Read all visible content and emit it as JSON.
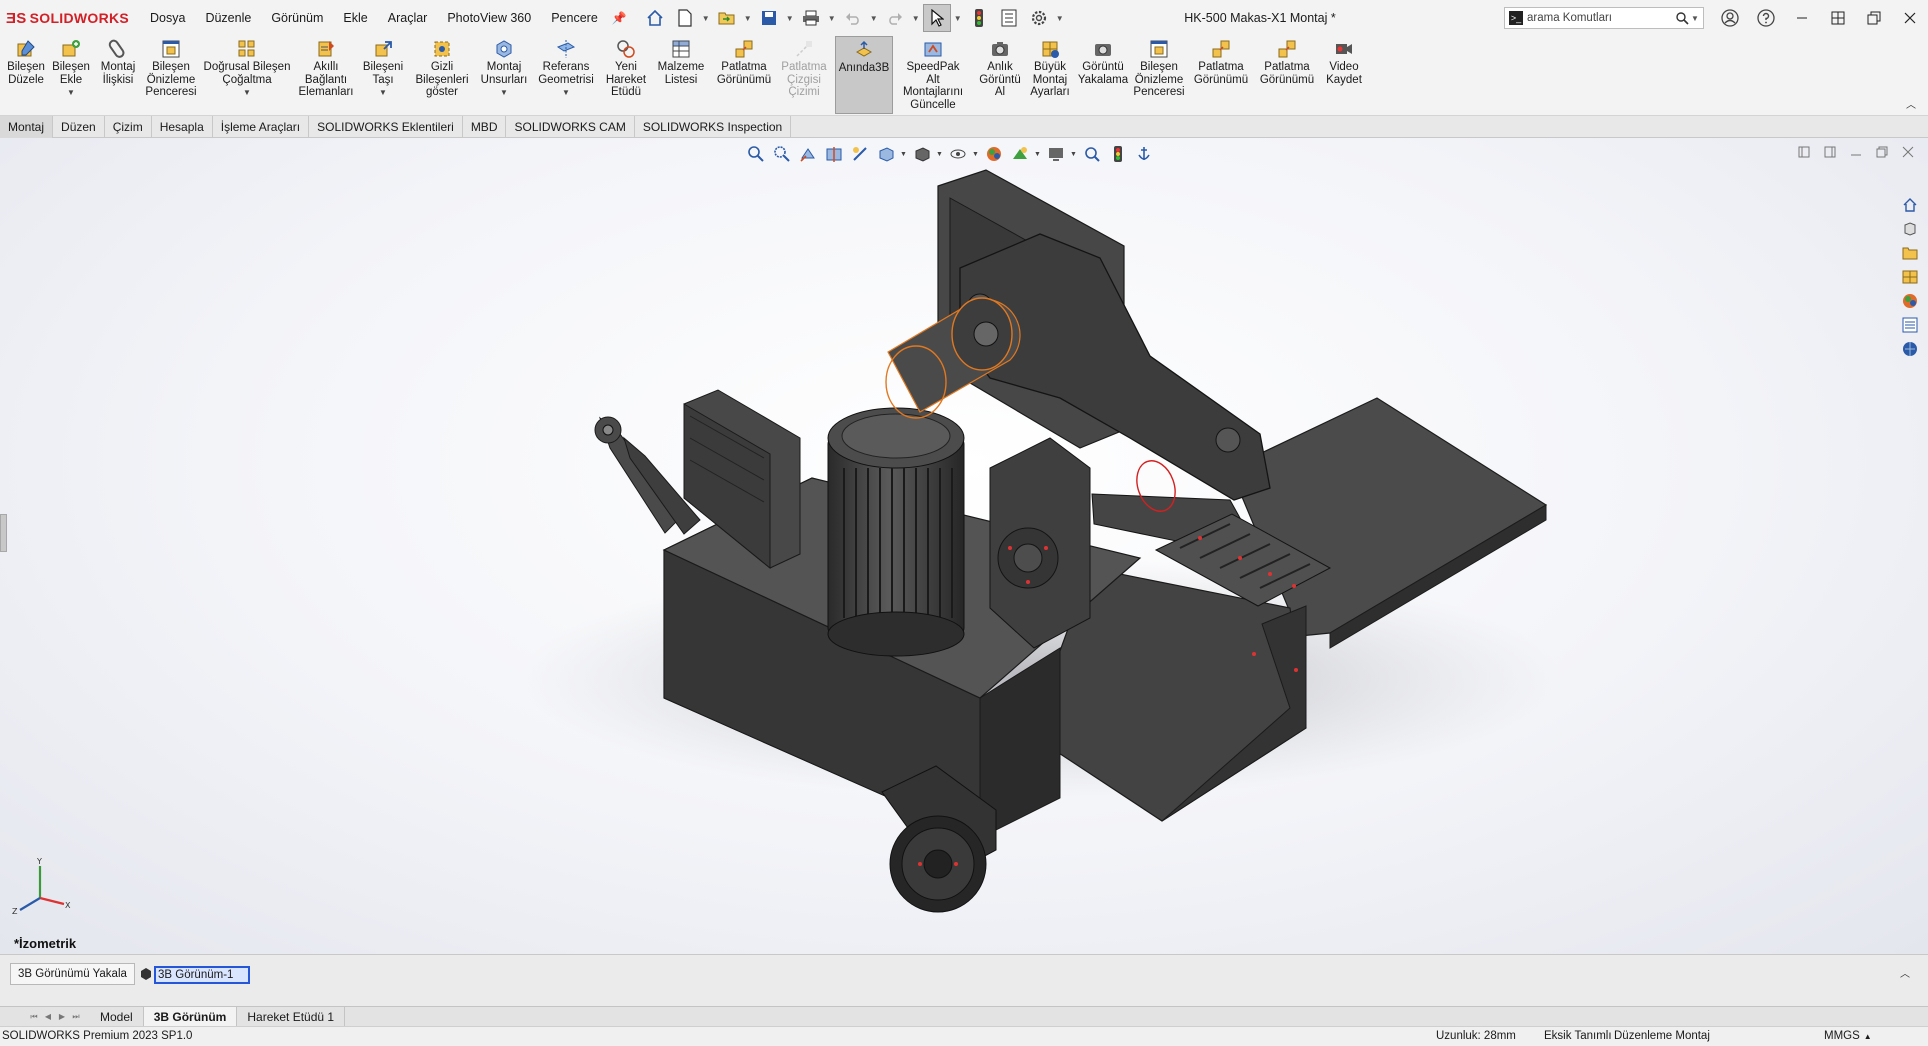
{
  "app": {
    "brand": "SOLIDWORKS",
    "document_title": "HK-500 Makas-X1 Montaj *"
  },
  "menu": [
    "Dosya",
    "Düzenle",
    "Görünüm",
    "Ekle",
    "Araçlar",
    "PhotoView 360",
    "Pencere"
  ],
  "search": {
    "placeholder": "arama Komutları"
  },
  "ribbon": {
    "buttons": [
      {
        "label": "Bileşen\nDüzele",
        "icon": "edit-component-icon"
      },
      {
        "label": "Bileşen\nEkle",
        "icon": "insert-component-icon"
      },
      {
        "label": "Montaj\nİlişkisi",
        "icon": "mate-icon"
      },
      {
        "label": "Bileşen\nÖnizleme\nPenceresi",
        "icon": "component-preview-icon"
      },
      {
        "label": "Doğrusal Bileşen\nÇoğaltma",
        "icon": "linear-pattern-icon"
      },
      {
        "label": "Akıllı\nBağlantı\nElemanları",
        "icon": "smart-fasteners-icon"
      },
      {
        "label": "Bileşeni\nTaşı",
        "icon": "move-component-icon"
      },
      {
        "label": "Gizli\nBileşenleri\ngöster",
        "icon": "show-hidden-icon"
      },
      {
        "label": "Montaj\nUnsurları",
        "icon": "assembly-features-icon"
      },
      {
        "label": "Referans\nGeometrisi",
        "icon": "reference-geometry-icon"
      },
      {
        "label": "Yeni\nHareket\nEtüdü",
        "icon": "new-motion-study-icon"
      },
      {
        "label": "Malzeme\nListesi",
        "icon": "bom-icon"
      },
      {
        "label": "Patlatma\nGörünümü",
        "icon": "exploded-view-icon"
      },
      {
        "label": "Patlatma\nÇizgisi\nÇizimi",
        "icon": "explode-line-icon"
      },
      {
        "label": "Anında3B",
        "icon": "instant3d-icon"
      },
      {
        "label": "SpeedPak\nAlt\nMontajlarını\nGüncelle",
        "icon": "speedpak-icon"
      },
      {
        "label": "Anlık\nGörüntü\nAl",
        "icon": "snapshot-icon"
      },
      {
        "label": "Büyük\nMontaj\nAyarları",
        "icon": "large-assembly-icon"
      },
      {
        "label": "Görüntü\nYakalama",
        "icon": "image-capture-icon"
      },
      {
        "label": "Bileşen\nÖnizleme\nPenceresi",
        "icon": "component-preview-icon"
      },
      {
        "label": "Patlatma\nGörünümü",
        "icon": "exploded-view-icon"
      },
      {
        "label": "Patlatma\nGörünümü",
        "icon": "exploded-view-icon"
      },
      {
        "label": "Video\nKaydet",
        "icon": "record-video-icon"
      }
    ]
  },
  "cm_tabs": [
    "Montaj",
    "Düzen",
    "Çizim",
    "Hesapla",
    "İşleme Araçları",
    "SOLIDWORKS Eklentileri",
    "MBD",
    "SOLIDWORKS CAM",
    "SOLIDWORKS Inspection"
  ],
  "viewport": {
    "view_name": "*İzometrik"
  },
  "capture": {
    "button": "3B Görünümü Yakala",
    "view_name_value": "3B Görünüm-1"
  },
  "bottom_tabs": [
    "Model",
    "3B Görünüm",
    "Hareket Etüdü 1"
  ],
  "status": {
    "version": "SOLIDWORKS Premium 2023 SP1.0",
    "length": "Uzunluk: 28mm",
    "definition": "Eksik Tanımlı",
    "mode": "Düzenleme Montaj",
    "units": "MMGS"
  },
  "colors": {
    "brand": "#d32027",
    "accent": "#2656d8",
    "model": "#4a4a4a",
    "selection": "#e07820"
  }
}
